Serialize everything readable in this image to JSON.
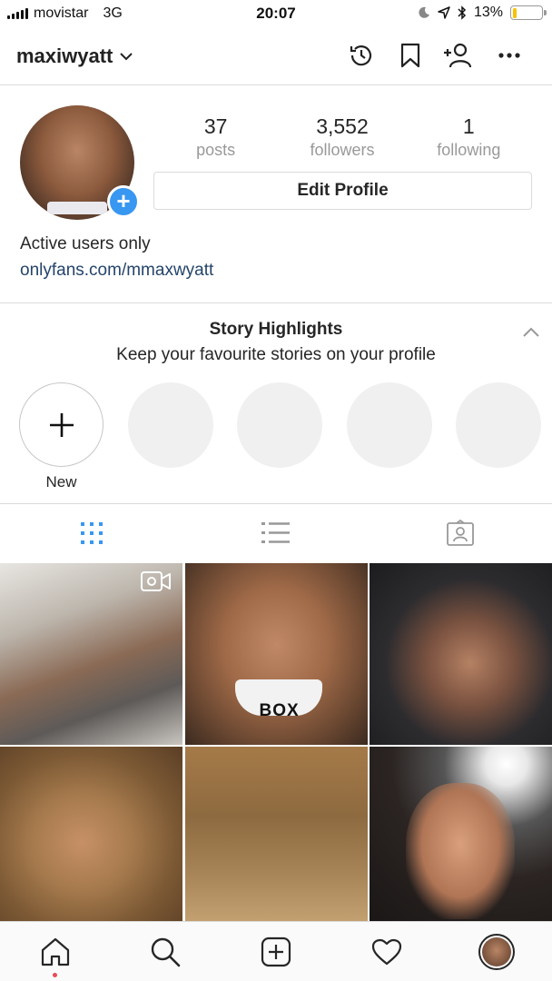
{
  "status_bar": {
    "carrier": "movistar",
    "network": "3G",
    "time": "20:07",
    "battery_percent": "13%",
    "battery_level": 0.13
  },
  "header": {
    "username": "maxiwyatt",
    "icons": [
      "archive-icon",
      "bookmark-icon",
      "discover-people-icon",
      "more-icon"
    ]
  },
  "profile": {
    "stats": [
      {
        "value": "37",
        "label": "posts"
      },
      {
        "value": "3,552",
        "label": "followers"
      },
      {
        "value": "1",
        "label": "following"
      }
    ],
    "edit_profile_label": "Edit Profile",
    "bio": "Active users only",
    "link": "onlyfans.com/mmaxwyatt"
  },
  "highlights": {
    "title": "Story Highlights",
    "subtitle": "Keep your favourite stories on your profile",
    "new_label": "New"
  },
  "tabs": [
    "grid-view",
    "list-view",
    "tagged"
  ],
  "grid": {
    "photos": [
      {
        "has_video": true
      },
      {
        "caption_text": "BOX"
      },
      {},
      {},
      {},
      {}
    ]
  },
  "bottom_nav": [
    "home",
    "search",
    "new-post",
    "activity",
    "profile"
  ],
  "colors": {
    "accent": "#3897f0",
    "link": "#24446b",
    "muted": "#999999",
    "notification_dot": "#ed4956",
    "battery": "#f5c400"
  }
}
